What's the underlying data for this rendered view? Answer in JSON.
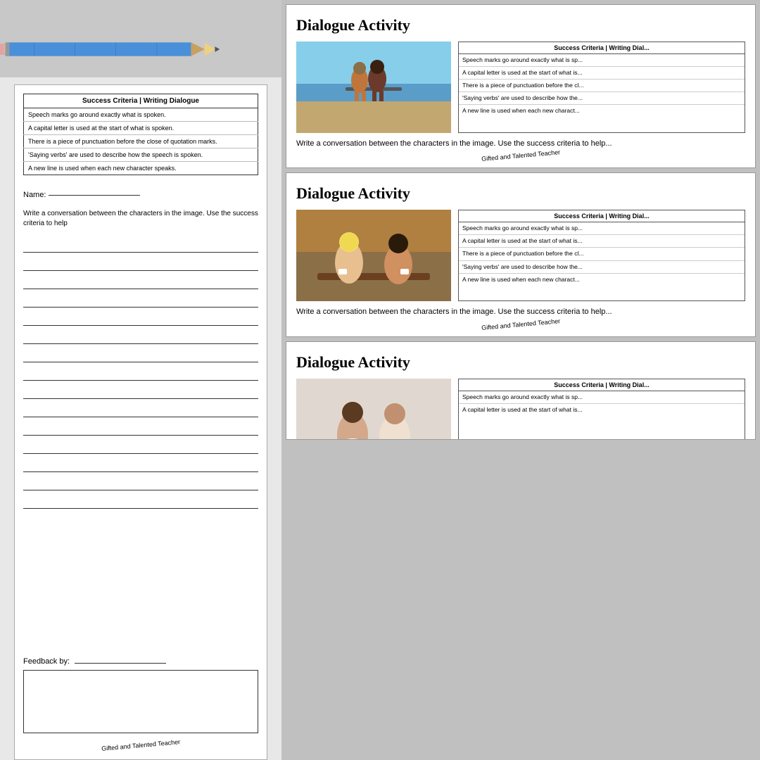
{
  "left": {
    "worksheet": {
      "success_criteria_header": "Success Criteria | Writing Dialogue",
      "criteria": [
        "Speech marks go around exactly what is spoken.",
        "A capital letter is used at the start of what is spoken.",
        "There is a piece of punctuation before the close of quotation marks.",
        "'Saying verbs' are used to describe how the speech is spoken.",
        "A new line is used when each new character speaks."
      ],
      "name_label": "Name: ",
      "name_underline": "________________",
      "writing_prompt": "Write a conversation between the characters in the image. Use the success criteria to help",
      "feedback_label": "Feedback by:",
      "feedback_underline": "________________",
      "watermark": "Gifted and Talented Teacher"
    }
  },
  "right": {
    "cards": [
      {
        "title": "Dialogue Activity",
        "image_type": "beach",
        "image_alt": "Two people sitting on a bench at the beach",
        "success_criteria_header": "Success Criteria | Writing Dial...",
        "criteria": [
          "Speech marks go around exactly what is sp...",
          "A capital letter is used at the start of what is...",
          "There is a piece of punctuation before the cl...",
          "'Saying verbs' are used to describe how the...",
          "A new line is used when each new charact..."
        ],
        "prompt": "Write a conversation between the characters in the image. Use the success criteria to help...",
        "watermark": "Gifted and Talented Teacher"
      },
      {
        "title": "Dialogue Activity",
        "image_type": "cafe",
        "image_alt": "Two women laughing in a cafe with coffee cups",
        "success_criteria_header": "Success Criteria | Writing Dial...",
        "criteria": [
          "Speech marks go around exactly what is sp...",
          "A capital letter is used at the start of what is...",
          "There is a piece of punctuation before the cl...",
          "'Saying verbs' are used to describe how the...",
          "A new line is used when each new charact..."
        ],
        "prompt": "Write a conversation between the characters in the image. Use the success criteria to help...",
        "watermark": "Gifted and Talented Teacher"
      },
      {
        "title": "Dialogue Activity",
        "image_type": "office",
        "image_alt": "Two women in office setting",
        "success_criteria_header": "Success Criteria | Writing Dial...",
        "criteria": [
          "Speech marks go around exactly what is sp...",
          "A capital letter is used at the start of what is..."
        ],
        "prompt": "",
        "watermark": ""
      }
    ]
  },
  "icons": {}
}
